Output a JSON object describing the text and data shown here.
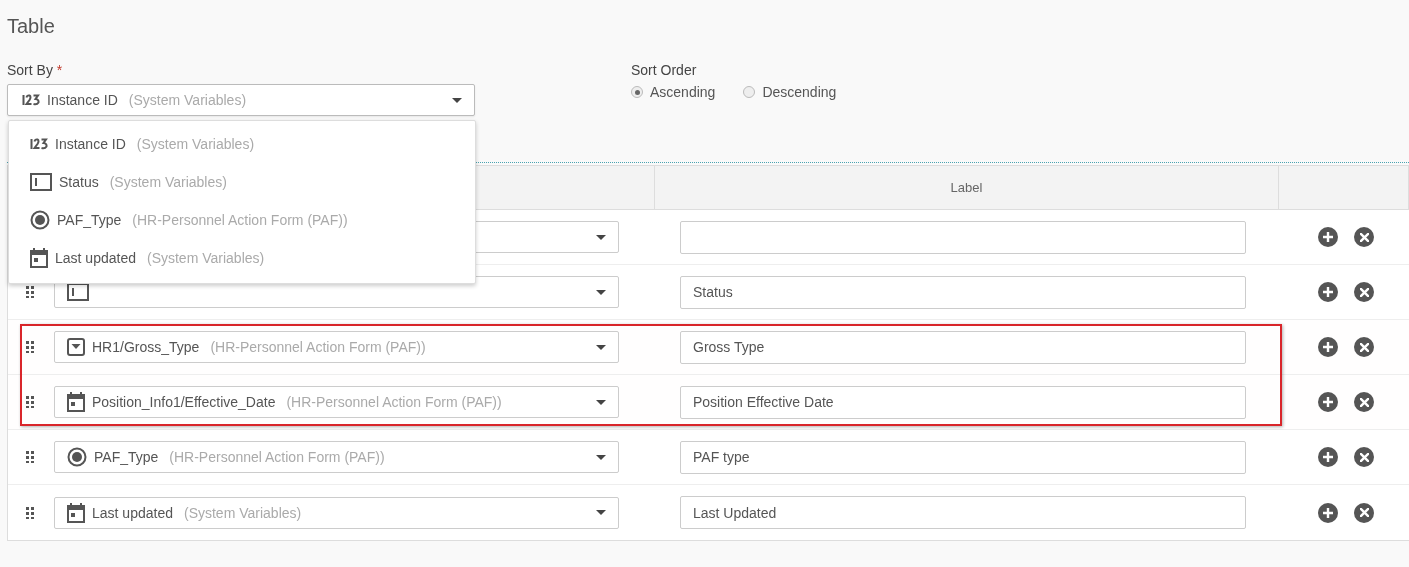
{
  "title": "Table",
  "sort_by": {
    "label": "Sort By",
    "required_mark": "*",
    "expanded": true,
    "value": {
      "kind": "number",
      "name": "Instance ID",
      "source": "(System Variables)"
    },
    "options": [
      {
        "kind": "number",
        "name": "Instance ID",
        "source": "(System Variables)"
      },
      {
        "kind": "text",
        "name": "Status",
        "source": "(System Variables)"
      },
      {
        "kind": "radio",
        "name": "PAF_Type",
        "source": "(HR-Personnel Action Form (PAF))"
      },
      {
        "kind": "date",
        "name": "Last updated",
        "source": "(System Variables)"
      }
    ]
  },
  "sort_order": {
    "label": "Sort Order",
    "options": [
      {
        "label": "Ascending",
        "selected": true
      },
      {
        "label": "Descending",
        "selected": false
      }
    ]
  },
  "table": {
    "columns": {
      "label": "Label"
    },
    "rows": [
      {
        "highlighted": false
      },
      {
        "highlighted": false,
        "field": {
          "kind": "text"
        },
        "label": "Status"
      },
      {
        "highlighted": true,
        "field": {
          "kind": "dropdown",
          "name": "HR1/Gross_Type",
          "source": "(HR-Personnel Action Form (PAF))"
        },
        "label": "Gross Type"
      },
      {
        "highlighted": true,
        "field": {
          "kind": "date",
          "name": "Position_Info1/Effective_Date",
          "source": "(HR-Personnel Action Form (PAF))"
        },
        "label": "Position Effective Date"
      },
      {
        "highlighted": false,
        "field": {
          "kind": "radio",
          "name": "PAF_Type",
          "source": "(HR-Personnel Action Form (PAF))"
        },
        "label": "PAF type"
      },
      {
        "highlighted": false,
        "field": {
          "kind": "date",
          "name": "Last updated",
          "source": "(System Variables)"
        },
        "label": "Last Updated"
      }
    ]
  }
}
